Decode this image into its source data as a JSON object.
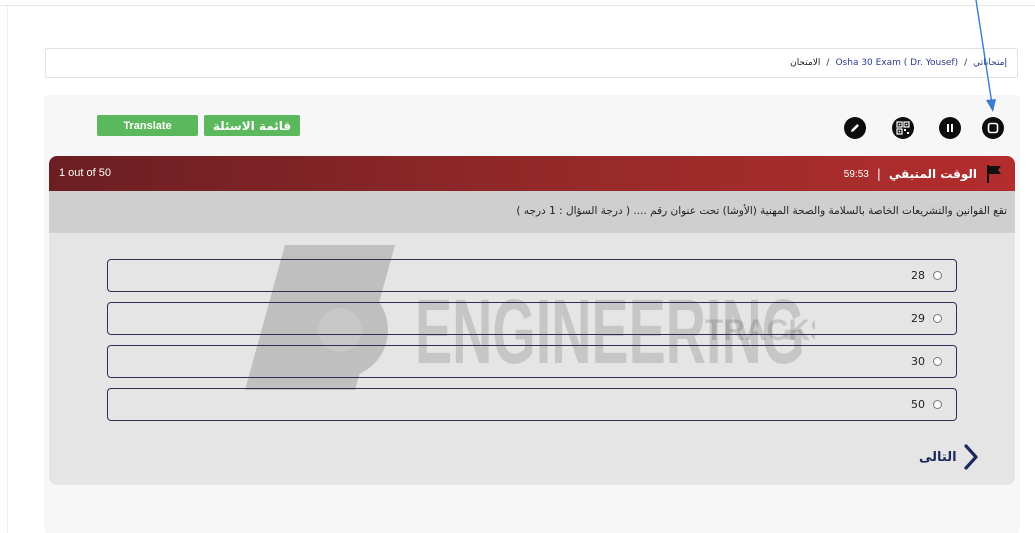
{
  "breadcrumb": {
    "home": "إمتحاناتي",
    "sep1": "/",
    "exam": "Osha 30 Exam ( Dr. Yousef)",
    "sep2": "/",
    "current": "الامتحان"
  },
  "toolbar": {
    "translate_label": "Translate",
    "question_list_label": "قائمة الاسئلة",
    "icons": [
      "pencil-icon",
      "qr-grid-icon",
      "pause-icon",
      "stop-icon"
    ]
  },
  "header": {
    "count": "1 out of 50",
    "time_label": "الوقت المتبقي",
    "time_sep": "|",
    "time_value": "59:53"
  },
  "question": {
    "text": "تقع القوانين والتشريعات الخاصة بالسلامة والصحة المهنية (الأوشا) تحت عنوان رقم .... (  درجة السؤال : 1 درجه )"
  },
  "options": [
    {
      "label": "28"
    },
    {
      "label": "29"
    },
    {
      "label": "30"
    },
    {
      "label": "50"
    }
  ],
  "navigation": {
    "next_label": "التالى"
  },
  "watermark": {
    "main": "ENGINEERING",
    "sub": "TRACKS"
  },
  "colors": {
    "header_red": "#b32d2d",
    "button_green": "#5cb85c",
    "option_border": "#2d2f5a",
    "annotation_arrow": "#3a7bd5"
  }
}
